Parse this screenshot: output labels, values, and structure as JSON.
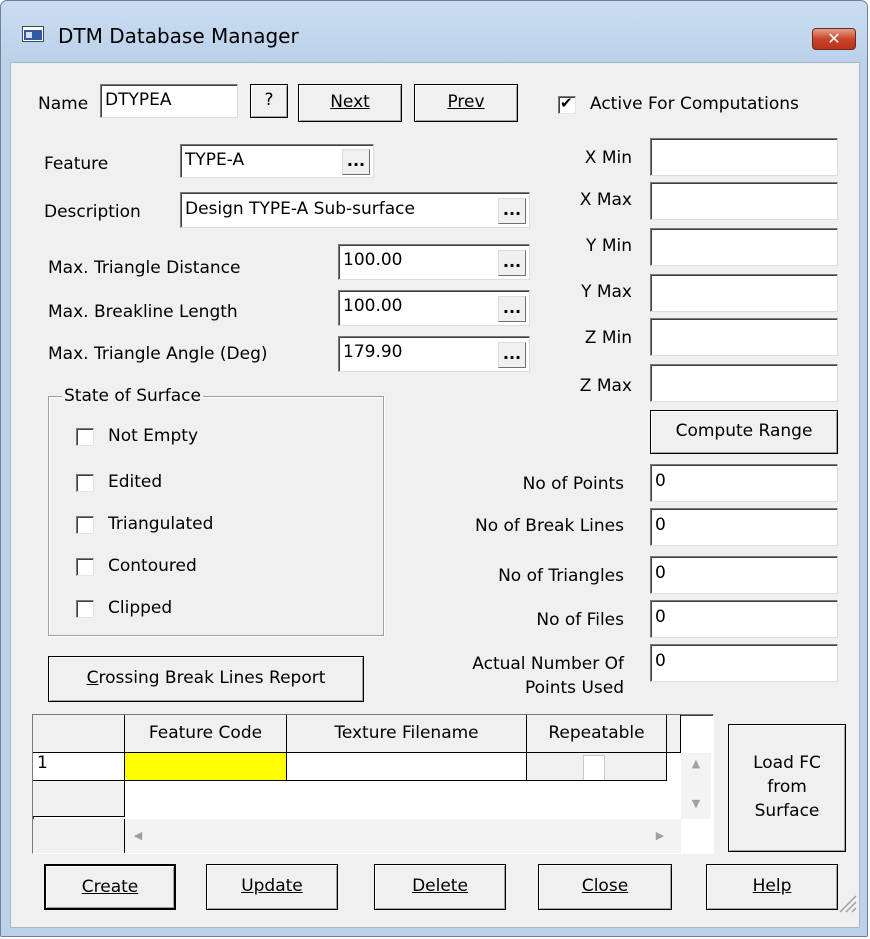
{
  "window": {
    "title": "DTM Database Manager",
    "close_glyph": "✕",
    "icon": "app-window-icon"
  },
  "name_row": {
    "name_label": "Name",
    "name_value": "DTYPEA",
    "help_label": "?",
    "next_label": "Next",
    "prev_label": "Prev",
    "active_label": "Active For  Computations",
    "active_checked": true
  },
  "feature": {
    "label": "Feature",
    "value": "TYPE-A",
    "browse": "..."
  },
  "description": {
    "label": "Description",
    "value": "Design TYPE-A Sub-surface",
    "browse": "..."
  },
  "max_triangle_distance": {
    "label": "Max. Triangle Distance",
    "value": "100.00",
    "browse": "..."
  },
  "max_breakline_length": {
    "label": "Max. Breakline Length",
    "value": "100.00",
    "browse": "..."
  },
  "max_triangle_angle": {
    "label": "Max. Triangle Angle (Deg)",
    "value": "179.90",
    "browse": "..."
  },
  "range": {
    "x_min_label": "X Min",
    "x_min": "",
    "x_max_label": "X Max",
    "x_max": "",
    "y_min_label": "Y Min",
    "y_min": "",
    "y_max_label": "Y Max",
    "y_max": "",
    "z_min_label": "Z Min",
    "z_min": "",
    "z_max_label": "Z Max",
    "z_max": "",
    "compute_label": "Compute Range"
  },
  "state": {
    "title": "State of Surface",
    "items": [
      {
        "label": "Not Empty",
        "checked": false
      },
      {
        "label": "Edited",
        "checked": false
      },
      {
        "label": "Triangulated",
        "checked": false
      },
      {
        "label": "Contoured",
        "checked": false
      },
      {
        "label": "Clipped",
        "checked": false
      }
    ]
  },
  "stats": {
    "points_label": "No of Points",
    "points": "0",
    "breaklines_label": "No of Break Lines",
    "breaklines": "0",
    "triangles_label": "No of Triangles",
    "triangles": "0",
    "files_label": "No of Files",
    "files": "0",
    "actual_label_1": "Actual Number Of",
    "actual_label_2": "Points Used",
    "actual": "0"
  },
  "crossing_report_label": "Crossing Break Lines Report",
  "grid": {
    "columns": [
      "Feature Code",
      "Texture Filename",
      "Repeatable"
    ],
    "rows": [
      {
        "num": "1",
        "feature_code": "",
        "texture": "",
        "repeatable": false
      }
    ],
    "highlight_color": "#ffff00"
  },
  "load_fc": {
    "line1": "Load FC",
    "line2": "from",
    "line3": "Surface"
  },
  "bottom": {
    "create": "Create",
    "update": "Update",
    "delete": "Delete",
    "close": "Close",
    "help": "Help"
  }
}
